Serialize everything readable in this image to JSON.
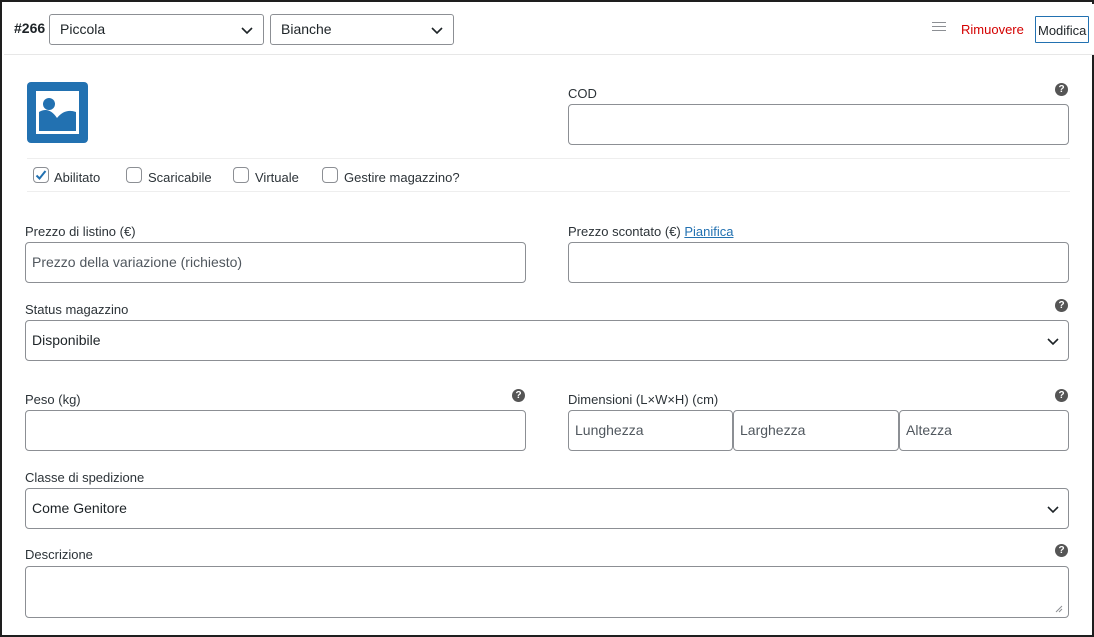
{
  "header": {
    "variation_id": "#266",
    "size_select": {
      "value": "Piccola"
    },
    "color_select": {
      "value": "Bianche"
    },
    "remove_label": "Rimuovere",
    "edit_label": "Modifica"
  },
  "sku": {
    "label": "COD",
    "value": ""
  },
  "checkboxes": [
    {
      "label": "Abilitato",
      "checked": true
    },
    {
      "label": "Scaricabile",
      "checked": false
    },
    {
      "label": "Virtuale",
      "checked": false
    },
    {
      "label": "Gestire magazzino?",
      "checked": false
    }
  ],
  "regular_price": {
    "label": "Prezzo di listino (€)",
    "placeholder": "Prezzo della variazione (richiesto)"
  },
  "sale_price": {
    "label": "Prezzo scontato (€)",
    "schedule_link": "Pianifica"
  },
  "stock_status": {
    "label": "Status magazzino",
    "value": "Disponibile"
  },
  "weight": {
    "label": "Peso (kg)"
  },
  "dimensions": {
    "label": "Dimensioni (L×W×H) (cm)",
    "length_placeholder": "Lunghezza",
    "width_placeholder": "Larghezza",
    "height_placeholder": "Altezza"
  },
  "shipping_class": {
    "label": "Classe di spedizione",
    "value": "Come Genitore"
  },
  "description": {
    "label": "Descrizione"
  },
  "help_glyph": "?",
  "colors": {
    "accent": "#2271b1",
    "remove": "#d40000",
    "border": "#8c8f94"
  }
}
